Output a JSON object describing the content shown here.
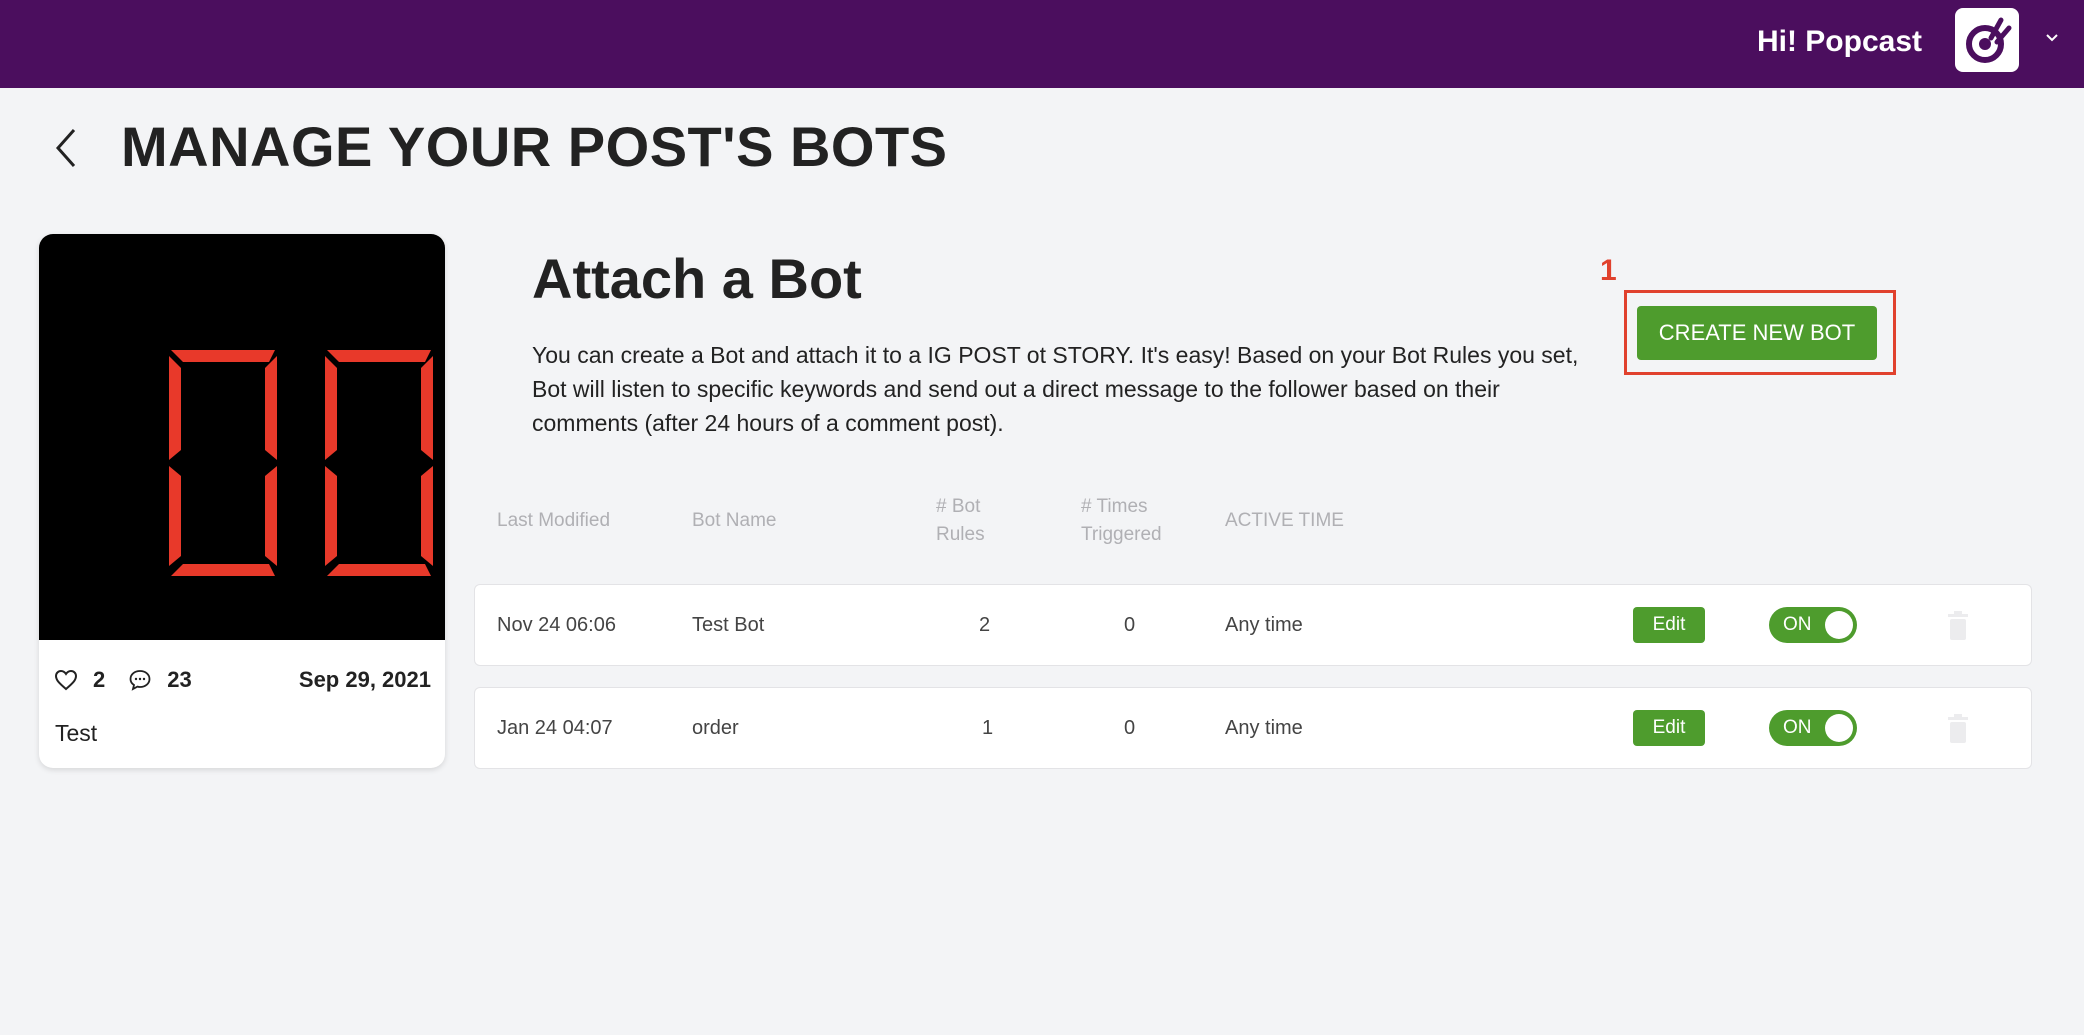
{
  "header": {
    "greeting": "Hi! Popcast",
    "avatar_icon": "brand-logo-icon",
    "menu_icon": "chevron-down-icon",
    "bg_color": "#4b0e5e"
  },
  "page": {
    "title": "MANAGE YOUR POST'S BOTS",
    "back_icon": "chevron-left-icon"
  },
  "post": {
    "likes": "2",
    "comments": "23",
    "date": "Sep 29, 2021",
    "caption": "Test",
    "image_text": "00",
    "image_color": "#e8392a"
  },
  "attach": {
    "title": "Attach a Bot",
    "description": "You can create a Bot and attach it to a IG POST ot STORY. It's easy! Based on your Bot Rules you set, Bot will listen to specific keywords and send out a direct message to the follower based on their comments (after 24 hours of a comment post).",
    "create_button": "CREATE NEW BOT",
    "annotation_number": "1",
    "accent_color": "#4e9c2d",
    "annotation_color": "#e0412d"
  },
  "table": {
    "headers": {
      "last_modified": "Last Modified",
      "bot_name": "Bot Name",
      "bot_rules_1": "# Bot",
      "bot_rules_2": "Rules",
      "times_triggered_1": "# Times",
      "times_triggered_2": "Triggered",
      "active_time": "ACTIVE TIME"
    },
    "rows": [
      {
        "last_modified": "Nov 24 06:06",
        "bot_name": "Test Bot",
        "bot_rules": "2",
        "times_triggered": "0",
        "active_time": "Any time",
        "edit_label": "Edit",
        "toggle_label": "ON"
      },
      {
        "last_modified": "Jan 24 04:07",
        "bot_name": "order",
        "bot_rules": "1",
        "times_triggered": "0",
        "active_time": "Any time",
        "edit_label": "Edit",
        "toggle_label": "ON"
      }
    ]
  }
}
